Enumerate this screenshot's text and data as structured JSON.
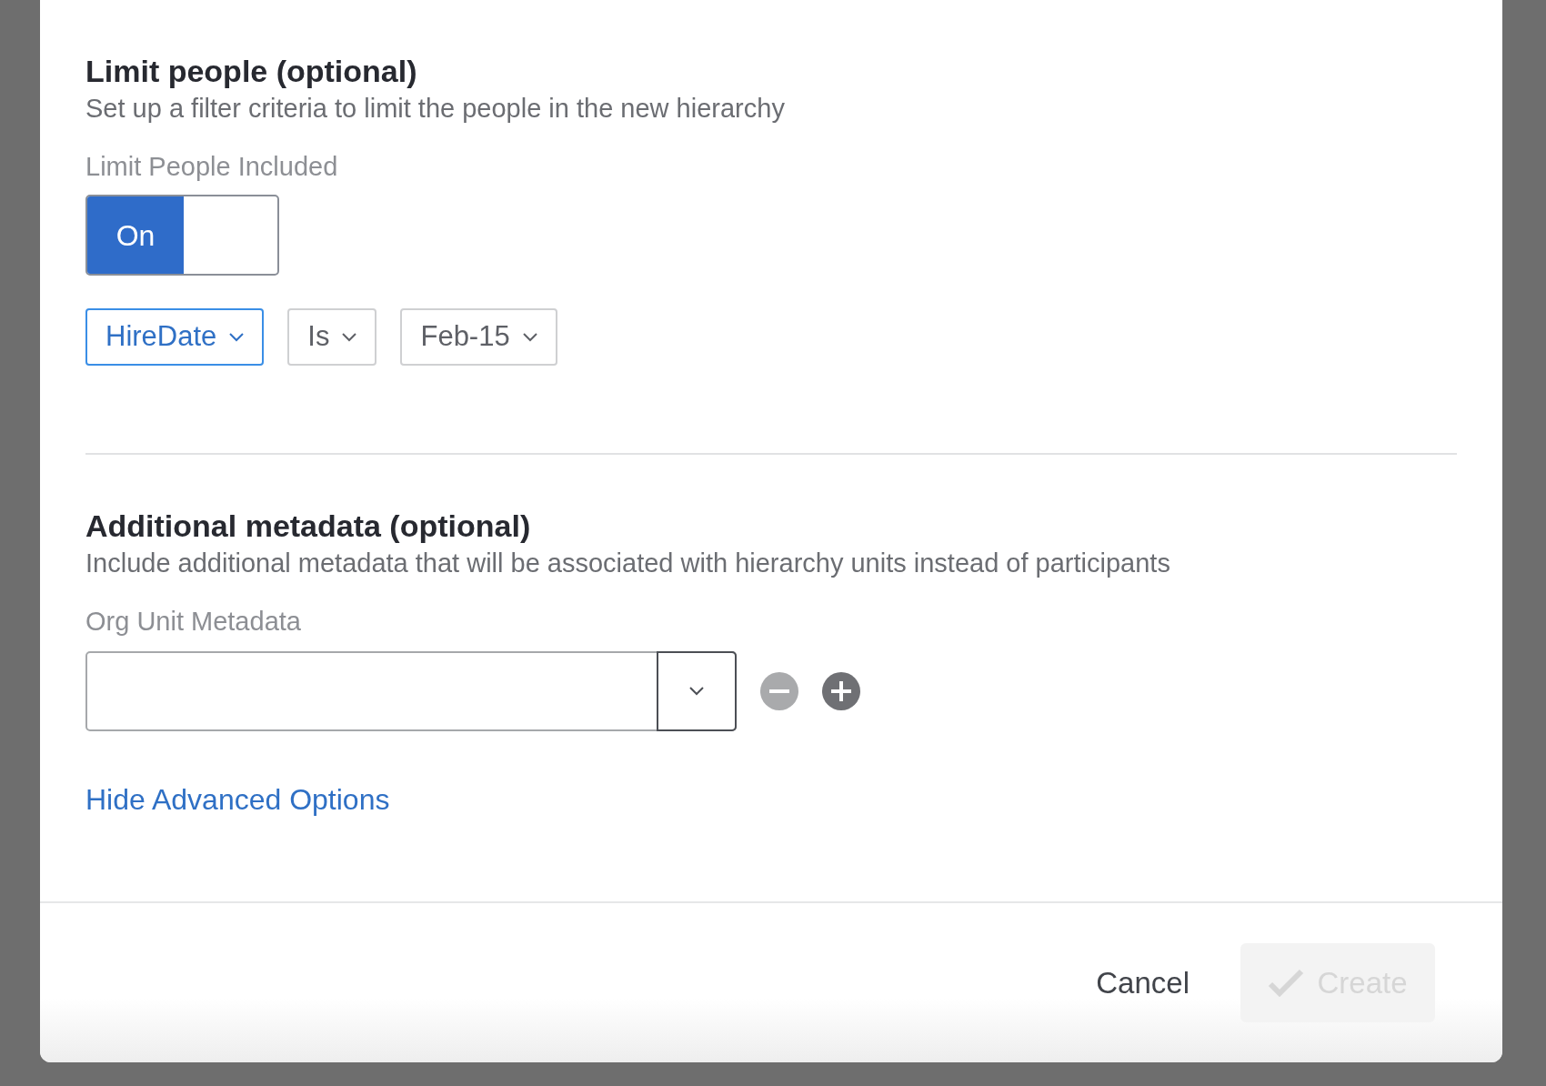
{
  "limit_section": {
    "title": "Limit people (optional)",
    "description": "Set up a filter criteria to limit the people in the new hierarchy",
    "toggle": {
      "label": "Limit People Included",
      "text": "On",
      "on": true
    },
    "filters": [
      {
        "value": "HireDate",
        "active": true
      },
      {
        "value": "Is",
        "active": false
      },
      {
        "value": "Feb-15",
        "active": false
      }
    ]
  },
  "metadata_section": {
    "title": "Additional metadata (optional)",
    "description": "Include additional metadata that will be associated with hierarchy units instead of participants",
    "field_label": "Org Unit Metadata",
    "remove_disabled": true,
    "add_disabled": false
  },
  "advanced_link": "Hide Advanced Options",
  "footer": {
    "cancel": "Cancel",
    "create": {
      "label": "Create",
      "disabled": true
    }
  }
}
